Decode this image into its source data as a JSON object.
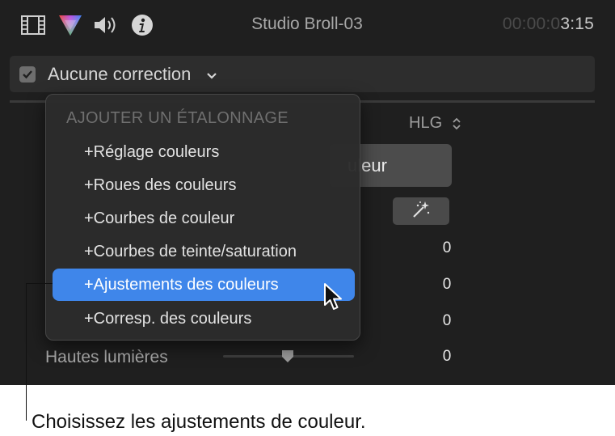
{
  "header": {
    "icons": [
      "film-icon",
      "color-wheel-icon",
      "speaker-icon",
      "info-icon"
    ],
    "title": "Studio Broll-03",
    "timecode_dim": "00:00:0",
    "timecode_bright": "3:15"
  },
  "correction": {
    "checked": true,
    "label": "Aucune correction"
  },
  "inspector": {
    "hlg_label": "HLG",
    "color_button_label": "uleur",
    "values": [
      "0",
      "0",
      "0",
      "0"
    ],
    "highlights_label": "Hautes lumières"
  },
  "menu": {
    "heading": "AJOUTER UN ÉTALONNAGE",
    "items": [
      "+Réglage couleurs",
      "+Roues des couleurs",
      "+Courbes de couleur",
      "+Courbes de teinte/saturation",
      "+Ajustements des couleurs",
      "+Corresp. des couleurs"
    ],
    "selected_index": 4
  },
  "callout": "Choisissez les ajustements de couleur.",
  "colors": {
    "panel_bg": "#1f1f1f",
    "menu_highlight": "#3f86ea"
  }
}
